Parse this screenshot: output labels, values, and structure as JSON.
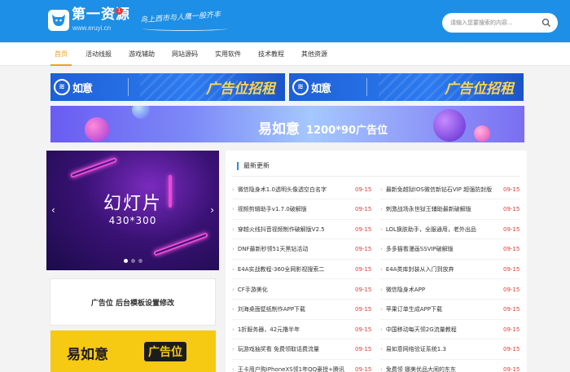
{
  "header": {
    "site_title": "第一资源",
    "badge": "1",
    "domain": "www.eruyi.cn",
    "slogan": "鸟上西市与人鹰一般齐丰",
    "search_placeholder": "请输入您要搜索的内容..."
  },
  "nav": {
    "items": [
      {
        "label": "首页",
        "active": true
      },
      {
        "label": "活动线报",
        "active": false
      },
      {
        "label": "游戏辅助",
        "active": false
      },
      {
        "label": "网站源码",
        "active": false
      },
      {
        "label": "实用软件",
        "active": false
      },
      {
        "label": "技术教程",
        "active": false
      },
      {
        "label": "其他资源",
        "active": false
      }
    ]
  },
  "ads": {
    "brand": "如意",
    "banner_slogan": "广告位招租",
    "wide_brand": "易如意",
    "wide_size": "1200*90广告位"
  },
  "slideshow": {
    "title": "幻灯片",
    "size": "430*300"
  },
  "side_ad": {
    "text": "广告位 后台模板设置修改"
  },
  "yellow_ad": {
    "brand": "易如意",
    "tag": "广告位"
  },
  "latest": {
    "heading": "最新更新",
    "left": [
      {
        "title": "微信隐身术1.0透明头像透空白名字",
        "date": "09-15"
      },
      {
        "title": "视频剪辑助手v1.7.0破解版",
        "date": "09-15"
      },
      {
        "title": "穿越火线抖音视频制作破解版V2.5",
        "date": "09-15"
      },
      {
        "title": "DNF最新秒领51天黑钻活动",
        "date": "09-15"
      },
      {
        "title": "E4A实战教程-360全网影视搜索二",
        "date": "09-15"
      },
      {
        "title": "CF手游美化",
        "date": "09-15"
      },
      {
        "title": "刘海桌面壁纸制作APP下载",
        "date": "09-15"
      },
      {
        "title": "1折服务器，42元撸半年",
        "date": "09-15"
      },
      {
        "title": "玩游戏抽奖看 免费领取话费流量",
        "date": "09-15"
      },
      {
        "title": "王卡用户购iPhoneXS领1年QQ豪授+腾讯",
        "date": "09-15"
      }
    ],
    "right": [
      {
        "title": "最新免越狱IOS微信新钻石VIP 超强防封版",
        "date": "09-15"
      },
      {
        "title": "刺激战场永世狱王辅助最新破解版",
        "date": "09-15"
      },
      {
        "title": "LOL换肤助手，全服通用，老外出品",
        "date": "09-15"
      },
      {
        "title": "多多猫看漫画SSVIP破解版",
        "date": "09-15"
      },
      {
        "title": "E4A类库封装从入门到放弃",
        "date": "09-15"
      },
      {
        "title": "微信隐身术APP",
        "date": "09-15"
      },
      {
        "title": "苹果订单生成APP下载",
        "date": "09-15"
      },
      {
        "title": "中国移动每天领2G流量教程",
        "date": "09-15"
      },
      {
        "title": "易如意网络验证系统1.3",
        "date": "09-15"
      },
      {
        "title": "免费领 娜美优品大闹的东东",
        "date": "09-15"
      }
    ]
  },
  "colors": {
    "header_bg": "#1e8fe6",
    "nav_active": "#f0a01c",
    "date_red": "#e53935",
    "yellow_ad": "#f6c913"
  }
}
